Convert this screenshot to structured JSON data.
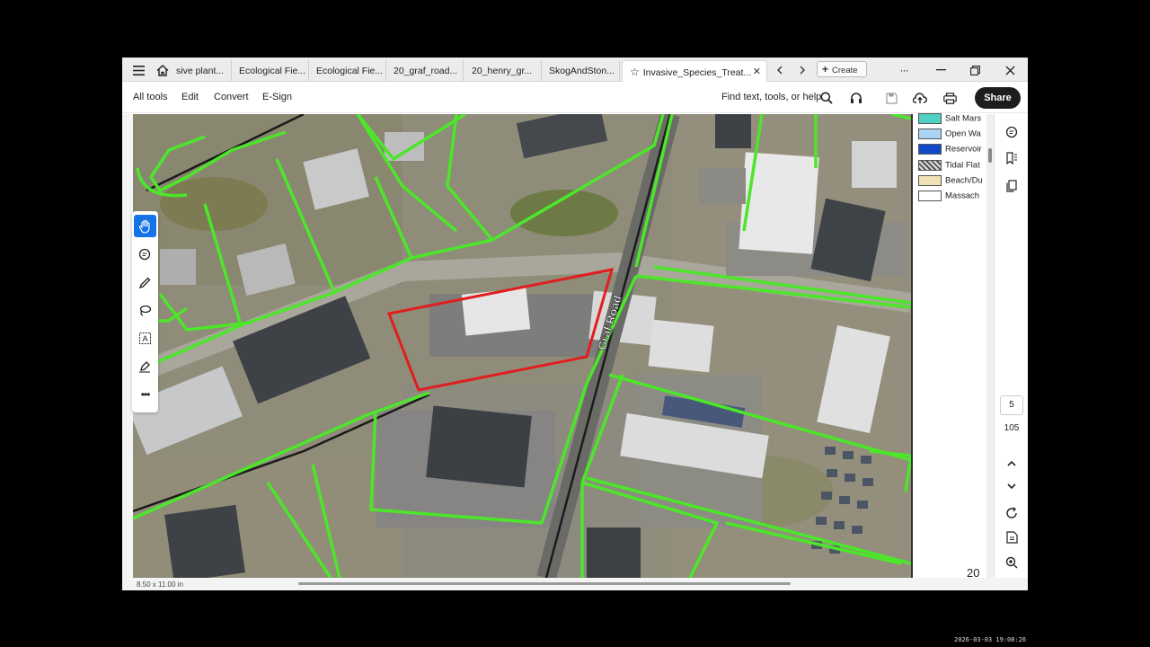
{
  "tabs": [
    {
      "label": "sive plant..."
    },
    {
      "label": "Ecological Fie..."
    },
    {
      "label": "Ecological Fie..."
    },
    {
      "label": "20_graf_road..."
    },
    {
      "label": "20_henry_gr..."
    },
    {
      "label": "SkogAndSton..."
    },
    {
      "label": "Invasive_Species_Treat...",
      "active": true
    }
  ],
  "tabbar": {
    "create_label": "Create",
    "more_label": "···"
  },
  "toolbar": {
    "menu": [
      "All tools",
      "Edit",
      "Convert",
      "E-Sign"
    ],
    "find_label": "Find text, tools, or help",
    "share_label": "Share"
  },
  "map": {
    "road_label": "Graf Road",
    "colors": {
      "parcel_lines": "#4ce62a",
      "highlight": "#e01e1e",
      "road": "#1b1b1b"
    }
  },
  "legend": {
    "items": [
      {
        "label": "Salt Mars",
        "color": "#4fd1c5"
      },
      {
        "label": "Open Wa",
        "color": "#aad4f5"
      },
      {
        "label": "Reservoir",
        "color": "#1248c8"
      },
      {
        "label": "Tidal Flat",
        "color": "#5a5a5a"
      },
      {
        "label": "Beach/Du",
        "color": "#efe3b6"
      },
      {
        "label": "Massach",
        "color": "#ffffff"
      }
    ],
    "page_number": "20"
  },
  "navigation": {
    "current_page": "5",
    "total_pages": "105"
  },
  "statusbar": {
    "page_size": "8.50 x 11.00 in"
  },
  "timestamp": "2026-03-03  19:08:26"
}
